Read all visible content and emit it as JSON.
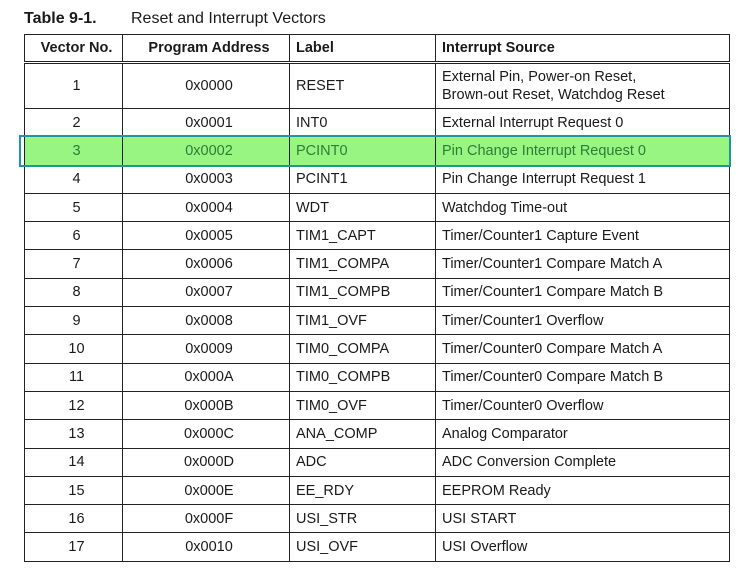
{
  "caption": {
    "number": "Table 9-1.",
    "title": "Reset and Interrupt Vectors"
  },
  "table": {
    "headers": [
      "Vector No.",
      "Program Address",
      "Label",
      "Interrupt Source"
    ],
    "rows": [
      {
        "vector": "1",
        "address": "0x0000",
        "label": "RESET",
        "source_line1": "External Pin, Power-on Reset,",
        "source_line2": "Brown-out Reset, Watchdog Reset"
      },
      {
        "vector": "2",
        "address": "0x0001",
        "label": "INT0",
        "source_line1": "External Interrupt Request 0"
      },
      {
        "vector": "3",
        "address": "0x0002",
        "label": "PCINT0",
        "source_line1": "Pin Change Interrupt Request 0",
        "highlighted": true
      },
      {
        "vector": "4",
        "address": "0x0003",
        "label": "PCINT1",
        "source_line1": "Pin Change Interrupt Request 1"
      },
      {
        "vector": "5",
        "address": "0x0004",
        "label": "WDT",
        "source_line1": "Watchdog Time-out"
      },
      {
        "vector": "6",
        "address": "0x0005",
        "label": "TIM1_CAPT",
        "source_line1": "Timer/Counter1 Capture Event"
      },
      {
        "vector": "7",
        "address": "0x0006",
        "label": "TIM1_COMPA",
        "source_line1": "Timer/Counter1 Compare Match A"
      },
      {
        "vector": "8",
        "address": "0x0007",
        "label": "TIM1_COMPB",
        "source_line1": "Timer/Counter1 Compare Match B"
      },
      {
        "vector": "9",
        "address": "0x0008",
        "label": "TIM1_OVF",
        "source_line1": "Timer/Counter1 Overflow"
      },
      {
        "vector": "10",
        "address": "0x0009",
        "label": "TIM0_COMPA",
        "source_line1": "Timer/Counter0 Compare Match A"
      },
      {
        "vector": "11",
        "address": "0x000A",
        "label": "TIM0_COMPB",
        "source_line1": "Timer/Counter0 Compare Match B"
      },
      {
        "vector": "12",
        "address": "0x000B",
        "label": "TIM0_OVF",
        "source_line1": "Timer/Counter0 Overflow"
      },
      {
        "vector": "13",
        "address": "0x000C",
        "label": "ANA_COMP",
        "source_line1": "Analog Comparator"
      },
      {
        "vector": "14",
        "address": "0x000D",
        "label": "ADC",
        "source_line1": "ADC Conversion Complete"
      },
      {
        "vector": "15",
        "address": "0x000E",
        "label": "EE_RDY",
        "source_line1": "EEPROM Ready"
      },
      {
        "vector": "16",
        "address": "0x000F",
        "label": "USI_STR",
        "source_line1": "USI START"
      },
      {
        "vector": "17",
        "address": "0x0010",
        "label": "USI_OVF",
        "source_line1": "USI Overflow"
      }
    ]
  },
  "highlight": {
    "fill_color": "#98f582",
    "text_color": "#2e7d35",
    "frame_color": "#1e96a0"
  }
}
